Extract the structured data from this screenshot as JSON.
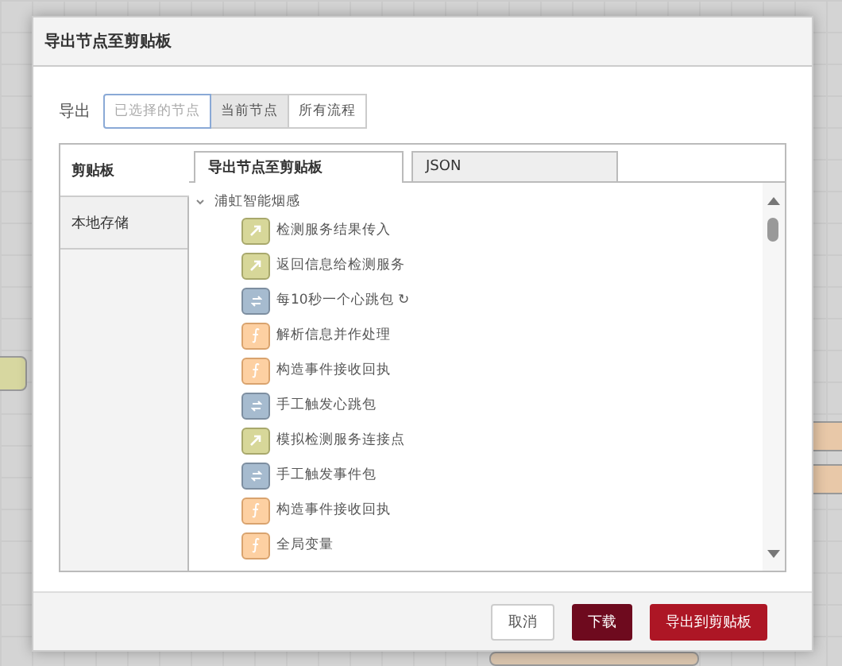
{
  "dialog": {
    "title": "导出节点至剪贴板"
  },
  "export_label": "导出",
  "export_options": [
    {
      "label": "已选择的节点",
      "selected": false,
      "disabled": true
    },
    {
      "label": "当前节点",
      "selected": true,
      "disabled": false
    },
    {
      "label": "所有流程",
      "selected": false,
      "disabled": false
    }
  ],
  "sidebar": {
    "items": [
      {
        "label": "剪贴板",
        "selected": true
      },
      {
        "label": "本地存储",
        "selected": false
      }
    ]
  },
  "tabs": [
    {
      "label": "导出节点至剪贴板",
      "selected": true
    },
    {
      "label": "JSON",
      "selected": false
    }
  ],
  "tree": [
    {
      "label": "浦虹智能烟感",
      "expanded": true,
      "children": [
        {
          "label": "检测服务结果传入",
          "kind": "link"
        },
        {
          "label": "返回信息给检测服务",
          "kind": "link"
        },
        {
          "label": "每10秒一个心跳包 ↻",
          "kind": "inject"
        },
        {
          "label": "解析信息并作处理",
          "kind": "function"
        },
        {
          "label": "构造事件接收回执",
          "kind": "function"
        },
        {
          "label": "手工触发心跳包",
          "kind": "inject"
        },
        {
          "label": "模拟检测服务连接点",
          "kind": "link"
        },
        {
          "label": "手工触发事件包",
          "kind": "inject"
        },
        {
          "label": "构造事件接收回执",
          "kind": "function"
        },
        {
          "label": "全局变量",
          "kind": "function"
        }
      ]
    }
  ],
  "buttons": [
    {
      "label": "取消",
      "kind": "plain"
    },
    {
      "label": "下载",
      "kind": "dark"
    },
    {
      "label": "导出到剪贴板",
      "kind": "primary"
    }
  ]
}
